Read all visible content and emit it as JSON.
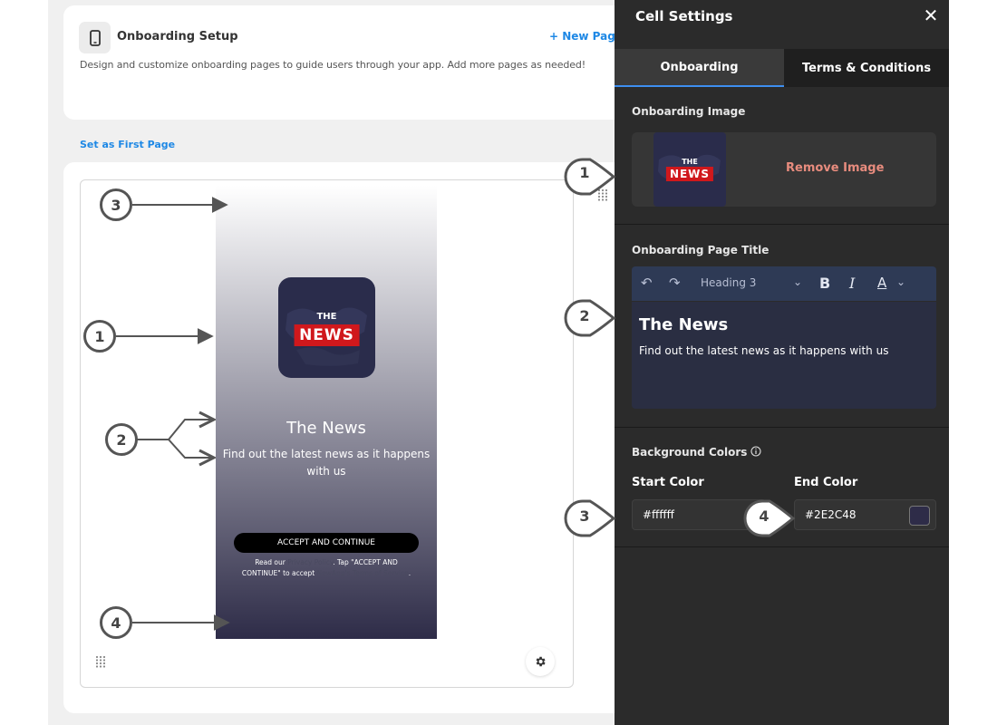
{
  "setup": {
    "title": "Onboarding Setup",
    "new_page_label": "New Page",
    "description": "Design and customize onboarding pages to guide users through your app. Add more pages as needed!",
    "set_first_page": "Set as First Page"
  },
  "preview": {
    "logo_top": "THE",
    "logo_bottom": "NEWS",
    "title": "The News",
    "subtitle": "Find out the latest news as it happens with us",
    "accept_button": "ACCEPT AND CONTINUE",
    "legal_prefix": "Read our ",
    "legal_link1": "Privacy Policy",
    "legal_mid": ". Tap \"ACCEPT AND CONTINUE\" to accept ",
    "legal_link2": "NewApp's Terms of Service",
    "legal_suffix": "."
  },
  "panel": {
    "title": "Cell Settings",
    "tabs": [
      {
        "label": "Onboarding",
        "active": true
      },
      {
        "label": "Terms & Conditions",
        "active": false
      }
    ],
    "image_section": {
      "label": "Onboarding Image",
      "remove_label": "Remove Image",
      "thumb_top": "THE",
      "thumb_bottom": "NEWS"
    },
    "title_section": {
      "label": "Onboarding Page Title",
      "format": "Heading 3",
      "heading_text": "The News",
      "body_text": "Find out the latest news as it happens with us"
    },
    "bg_section": {
      "label": "Background Colors",
      "start_label": "Start Color",
      "start_value": "#ffffff",
      "end_label": "End Color",
      "end_value": "#2E2C48"
    }
  },
  "callouts": {
    "left": [
      "3",
      "1",
      "2",
      "4"
    ],
    "right": [
      "1",
      "2",
      "3",
      "4"
    ]
  },
  "colors": {
    "accent": "#1e88e5",
    "panel_bg": "#2b2b2b",
    "gradient_start": "#ffffff",
    "gradient_end": "#2e2c48",
    "remove": "#e88c7e",
    "news_red": "#d0181c"
  }
}
